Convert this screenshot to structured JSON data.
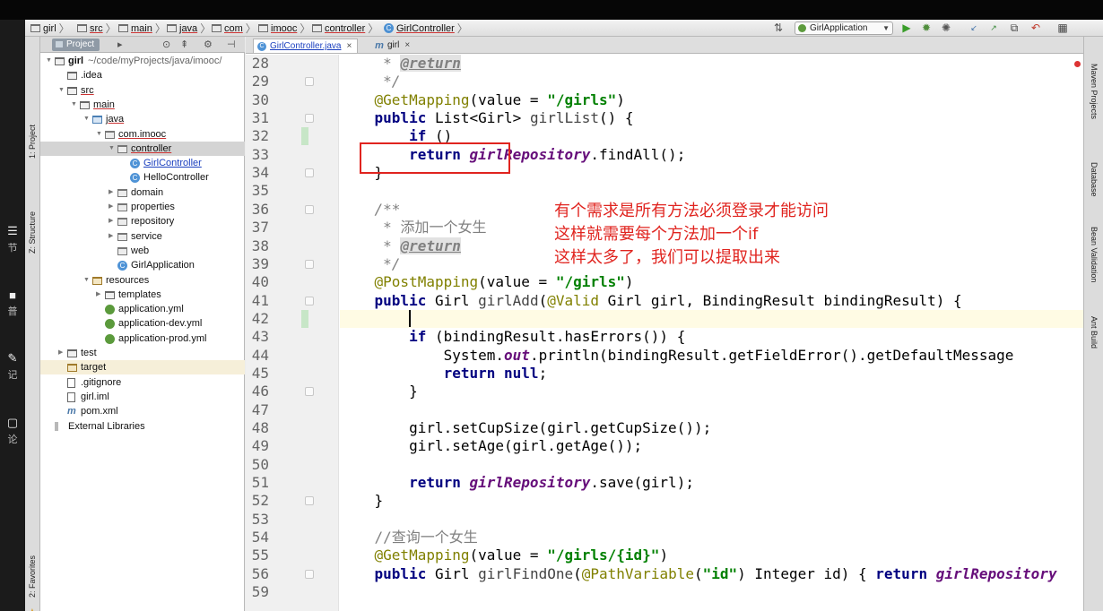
{
  "overlay_left": [
    {
      "glyph": "☰",
      "text": "节"
    },
    {
      "glyph": "■",
      "text": "普"
    },
    {
      "glyph": "✎",
      "text": "记"
    },
    {
      "glyph": "▢",
      "text": "论"
    }
  ],
  "breadcrumb": [
    {
      "label": "girl",
      "icon": "folder-icon"
    },
    {
      "label": "src",
      "icon": "folder-icon"
    },
    {
      "label": "main",
      "icon": "folder-icon"
    },
    {
      "label": "java",
      "icon": "folder-icon"
    },
    {
      "label": "com",
      "icon": "package-icon"
    },
    {
      "label": "imooc",
      "icon": "package-icon"
    },
    {
      "label": "controller",
      "icon": "package-icon"
    },
    {
      "label": "GirlController",
      "icon": "class-icon"
    }
  ],
  "toolbar": {
    "run_config": "GirlApplication",
    "buttons": [
      "build-icon",
      "run-icon",
      "debug-icon",
      "coverage-icon",
      "vcs-update-icon",
      "vcs-commit-icon",
      "compare-icon",
      "revert-icon",
      "project-structure-icon"
    ]
  },
  "left_tool_tabs": {
    "project": "1: Project",
    "structure": "Z: Structure",
    "favorites": "2: Favorites"
  },
  "right_tool_tabs": [
    "Maven Projects",
    "Database",
    "Bean Validation",
    "Ant Build"
  ],
  "project_panel": {
    "tab": "Project",
    "tree": [
      {
        "label": "girl",
        "extra": " ~/code/myProjects/java/imooc/",
        "depth": 0,
        "icon": "folder",
        "arrow": "down"
      },
      {
        "label": ".idea",
        "depth": 1,
        "icon": "folder"
      },
      {
        "label": "src",
        "depth": 1,
        "icon": "folder",
        "arrow": "down",
        "underline": true
      },
      {
        "label": "main",
        "depth": 2,
        "icon": "folder",
        "arrow": "down",
        "underline": true
      },
      {
        "label": "java",
        "depth": 3,
        "icon": "blue",
        "arrow": "down",
        "underline": true
      },
      {
        "label": "com.imooc",
        "depth": 4,
        "icon": "pkg",
        "arrow": "down",
        "underline": true
      },
      {
        "label": "controller",
        "depth": 5,
        "icon": "pkg",
        "arrow": "down",
        "selected": true,
        "underline": true
      },
      {
        "label": "GirlController",
        "depth": 6,
        "icon": "cls",
        "link": true
      },
      {
        "label": "HelloController",
        "depth": 6,
        "icon": "cls"
      },
      {
        "label": "domain",
        "depth": 5,
        "icon": "pkg",
        "arrow": "right"
      },
      {
        "label": "properties",
        "depth": 5,
        "icon": "pkg",
        "arrow": "right"
      },
      {
        "label": "repository",
        "depth": 5,
        "icon": "pkg",
        "arrow": "right"
      },
      {
        "label": "service",
        "depth": 5,
        "icon": "pkg",
        "arrow": "right"
      },
      {
        "label": "web",
        "depth": 5,
        "icon": "pkg"
      },
      {
        "label": "GirlApplication",
        "depth": 5,
        "icon": "cls"
      },
      {
        "label": "resources",
        "depth": 3,
        "icon": "res",
        "arrow": "down"
      },
      {
        "label": "templates",
        "depth": 4,
        "icon": "folder",
        "arrow": "right"
      },
      {
        "label": "application.yml",
        "depth": 4,
        "icon": "yml"
      },
      {
        "label": "application-dev.yml",
        "depth": 4,
        "icon": "yml"
      },
      {
        "label": "application-prod.yml",
        "depth": 4,
        "icon": "yml"
      },
      {
        "label": "test",
        "depth": 1,
        "icon": "folder",
        "arrow": "right"
      },
      {
        "label": "target",
        "depth": 1,
        "icon": "res",
        "highlight": true
      },
      {
        "label": ".gitignore",
        "depth": 1,
        "icon": "file"
      },
      {
        "label": "girl.iml",
        "depth": 1,
        "icon": "file"
      },
      {
        "label": "pom.xml",
        "depth": 1,
        "icon": "m"
      },
      {
        "label": "External Libraries",
        "depth": 0,
        "icon": "lib"
      }
    ]
  },
  "editor": {
    "tabs": [
      {
        "label": "GirlController.java",
        "icon": "C",
        "active": true
      },
      {
        "label": "girl",
        "icon": "m",
        "active": false
      }
    ],
    "line_numbers": [
      "28",
      "29",
      "30",
      "31",
      "32",
      "33",
      "34",
      "35",
      "36",
      "37",
      "38",
      "39",
      "40",
      "41",
      "42",
      "43",
      "44",
      "45",
      "46",
      "47",
      "48",
      "49",
      "50",
      "51",
      "52",
      "53",
      "54",
      "55",
      "56",
      "59"
    ],
    "lines": [
      [
        [
          "cm",
          "     * "
        ],
        [
          "tag",
          "@return"
        ]
      ],
      [
        [
          "cm",
          "     */"
        ]
      ],
      [
        [
          "an",
          "    @GetMapping"
        ],
        [
          "",
          "(value = "
        ],
        [
          "st",
          "\"/girls\""
        ],
        [
          "",
          ")"
        ]
      ],
      [
        [
          "kw",
          "    public "
        ],
        [
          "",
          "List<Girl> "
        ],
        [
          "mn",
          "girlList"
        ],
        [
          "",
          "() {"
        ]
      ],
      [
        [
          "kw",
          "        if "
        ],
        [
          "",
          "()"
        ]
      ],
      [
        [
          "kw",
          "        return "
        ],
        [
          "fd",
          "girlRepository"
        ],
        [
          "",
          ".findAll();"
        ]
      ],
      [
        [
          "",
          "    }"
        ]
      ],
      [
        [
          "",
          ""
        ]
      ],
      [
        [
          "cm",
          "    /**"
        ]
      ],
      [
        [
          "cm",
          "     * "
        ],
        [
          "cmz",
          "添加一个女生"
        ]
      ],
      [
        [
          "cm",
          "     * "
        ],
        [
          "tag",
          "@return"
        ]
      ],
      [
        [
          "cm",
          "     */"
        ]
      ],
      [
        [
          "an",
          "    @PostMapping"
        ],
        [
          "",
          "(value = "
        ],
        [
          "st",
          "\"/girls\""
        ],
        [
          "",
          ")"
        ]
      ],
      [
        [
          "kw",
          "    public "
        ],
        [
          "",
          "Girl "
        ],
        [
          "mn",
          "girlAdd"
        ],
        [
          "",
          "("
        ],
        [
          "an",
          "@Valid "
        ],
        [
          "",
          "Girl girl, BindingResult bindingResult) {"
        ]
      ],
      [
        [
          "",
          "        "
        ]
      ],
      [
        [
          "kw",
          "        if "
        ],
        [
          "",
          "(bindingResult.hasErrors()) {"
        ]
      ],
      [
        [
          "",
          "            System."
        ],
        [
          "fd",
          "out"
        ],
        [
          "",
          ".println(bindingResult.getFieldError().getDefaultMessage"
        ]
      ],
      [
        [
          "kw",
          "            return null"
        ],
        [
          "",
          ";"
        ]
      ],
      [
        [
          "",
          "        }"
        ]
      ],
      [
        [
          "",
          ""
        ]
      ],
      [
        [
          "",
          "        girl.setCupSize(girl.getCupSize());"
        ]
      ],
      [
        [
          "",
          "        girl.setAge(girl.getAge());"
        ]
      ],
      [
        [
          "",
          ""
        ]
      ],
      [
        [
          "kw",
          "        return "
        ],
        [
          "fd",
          "girlRepository"
        ],
        [
          "",
          ".save(girl);"
        ]
      ],
      [
        [
          "",
          "    }"
        ]
      ],
      [
        [
          "",
          ""
        ]
      ],
      [
        [
          "cmz",
          "    //查询一个女生"
        ]
      ],
      [
        [
          "an",
          "    @GetMapping"
        ],
        [
          "",
          "(value = "
        ],
        [
          "st",
          "\"/girls/{id}\""
        ],
        [
          "",
          ")"
        ]
      ],
      [
        [
          "kw",
          "    public "
        ],
        [
          "",
          "Girl "
        ],
        [
          "mn",
          "girlFindOne"
        ],
        [
          "",
          "("
        ],
        [
          "an",
          "@PathVariable"
        ],
        [
          "",
          "("
        ],
        [
          "st",
          "\"id\""
        ],
        [
          "",
          ") Integer id) { "
        ],
        [
          "kw",
          "return "
        ],
        [
          "fd",
          "girlRepository"
        ]
      ],
      [
        [
          "",
          ""
        ]
      ]
    ],
    "annotation_lines": [
      "有个需求是所有方法必须登录才能访问",
      "这样就需要每个方法加一个if",
      "这样太多了，我们可以提取出来"
    ]
  },
  "colors": {
    "annotation": "#e0241f",
    "current_line": "#fffbe4",
    "keyword": "#000080",
    "string": "#008000",
    "annotation_code": "#808000"
  }
}
